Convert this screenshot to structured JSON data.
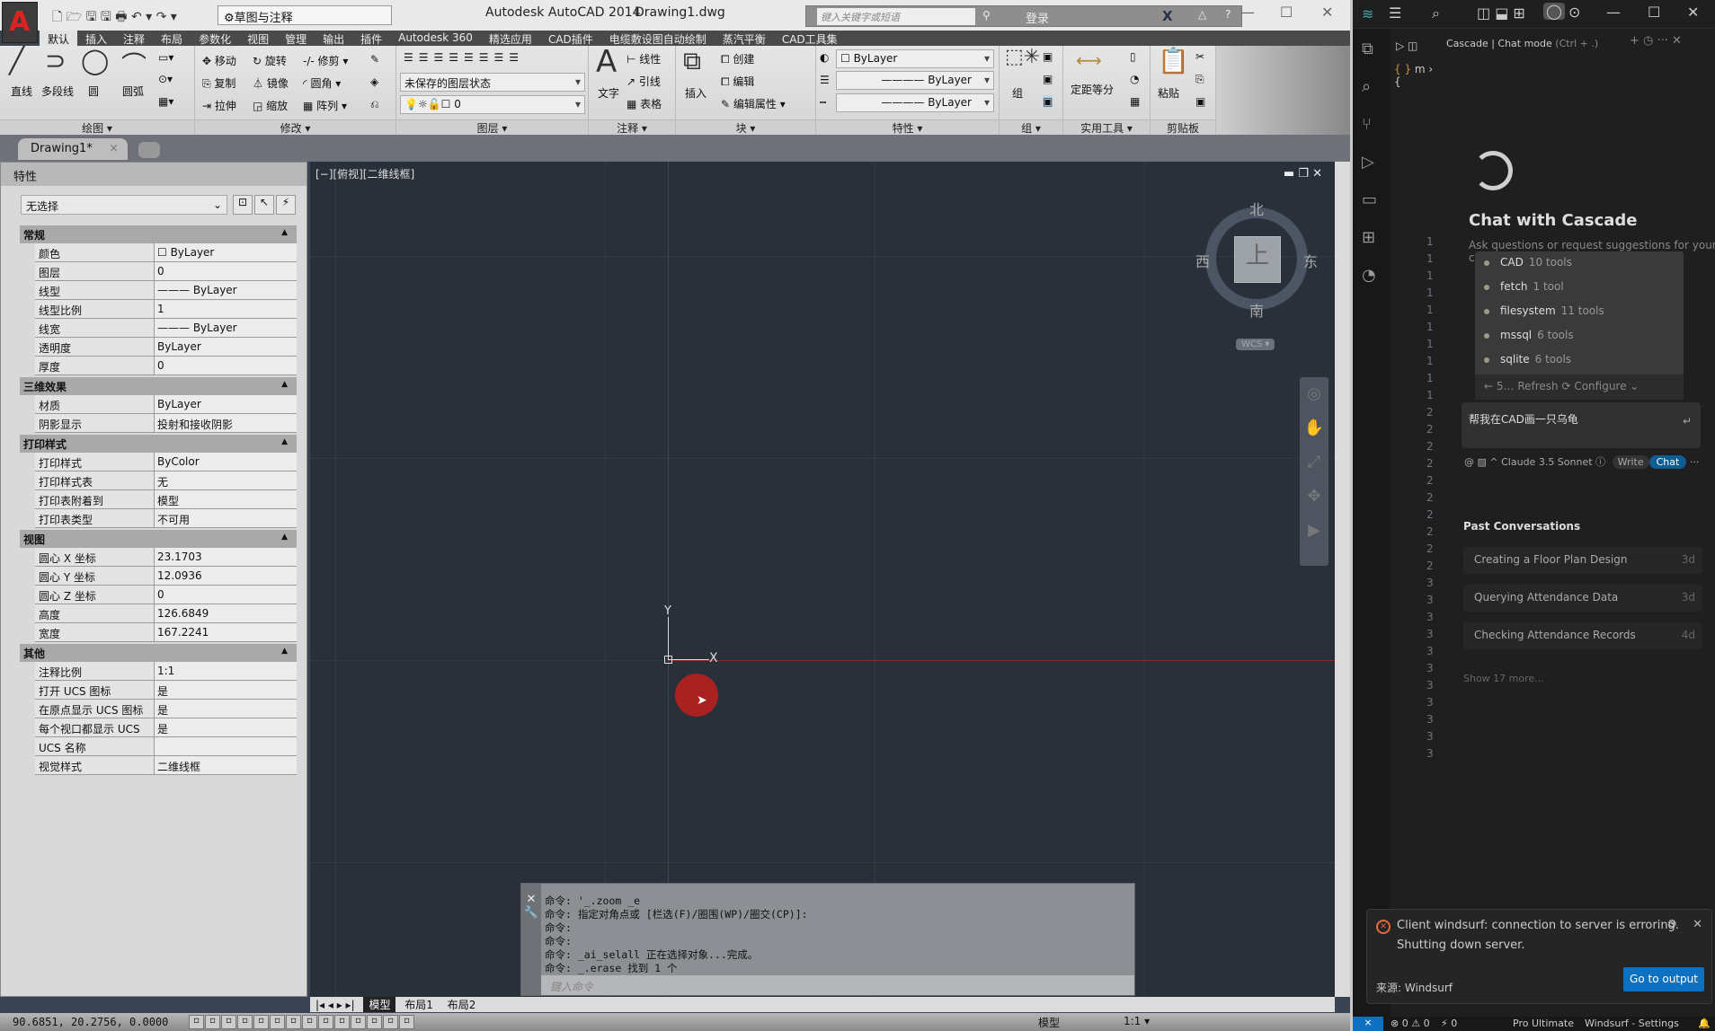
{
  "acad": {
    "title": "Autodesk AutoCAD 2014",
    "file": "Drawing1.dwg",
    "workspace": "草图与注释",
    "search_placeholder": "键入关键字或短语",
    "login": "登录",
    "menu_tabs": [
      "默认",
      "插入",
      "注释",
      "布局",
      "参数化",
      "视图",
      "管理",
      "输出",
      "插件",
      "Autodesk 360",
      "精选应用",
      "CAD插件",
      "电缆敷设图自动绘制",
      "蒸汽平衡",
      "CAD工具集"
    ],
    "ribbon": {
      "draw": {
        "label": "绘图 ▾",
        "items": [
          "直线",
          "多段线",
          "圆",
          "圆弧"
        ]
      },
      "modify": {
        "label": "修改 ▾",
        "items": [
          "移动",
          "旋转",
          "修剪",
          "复制",
          "镜像",
          "圆角",
          "拉伸",
          "缩放",
          "阵列"
        ]
      },
      "layer": {
        "label": "图层 ▾",
        "state": "未保存的图层状态",
        "current": "0"
      },
      "annotate": {
        "label": "注释 ▾",
        "text": "文字",
        "items": [
          "线性",
          "引线",
          "表格"
        ]
      },
      "block": {
        "label": "块 ▾",
        "insert": "插入",
        "items": [
          "创建",
          "编辑",
          "编辑属性"
        ]
      },
      "properties": {
        "label": "特性 ▾",
        "color": "ByLayer",
        "linetype": "ByLayer",
        "lineweight": "ByLayer"
      },
      "group": {
        "label": "组 ▾",
        "btn": "组"
      },
      "utilities": {
        "label": "实用工具 ▾",
        "btn": "定距等分"
      },
      "clipboard": {
        "label": "剪贴板",
        "btn": "粘贴"
      }
    },
    "doc_tab": "Drawing1*",
    "props": {
      "title": "特性",
      "selection": "无选择",
      "sections": [
        {
          "name": "常规",
          "rows": [
            [
              "颜色",
              "☐ ByLayer"
            ],
            [
              "图层",
              "0"
            ],
            [
              "线型",
              "——— ByLayer"
            ],
            [
              "线型比例",
              "1"
            ],
            [
              "线宽",
              "——— ByLayer"
            ],
            [
              "透明度",
              "ByLayer"
            ],
            [
              "厚度",
              "0"
            ]
          ]
        },
        {
          "name": "三维效果",
          "rows": [
            [
              "材质",
              "ByLayer"
            ],
            [
              "阴影显示",
              "投射和接收阴影"
            ]
          ]
        },
        {
          "name": "打印样式",
          "rows": [
            [
              "打印样式",
              "ByColor"
            ],
            [
              "打印样式表",
              "无"
            ],
            [
              "打印表附着到",
              "模型"
            ],
            [
              "打印表类型",
              "不可用"
            ]
          ]
        },
        {
          "name": "视图",
          "rows": [
            [
              "圆心 X 坐标",
              "23.1703"
            ],
            [
              "圆心 Y 坐标",
              "12.0936"
            ],
            [
              "圆心 Z 坐标",
              "0"
            ],
            [
              "高度",
              "126.6849"
            ],
            [
              "宽度",
              "167.2241"
            ]
          ]
        },
        {
          "name": "其他",
          "rows": [
            [
              "注释比例",
              "1:1"
            ],
            [
              "打开 UCS 图标",
              "是"
            ],
            [
              "在原点显示 UCS 图标",
              "是"
            ],
            [
              "每个视口都显示 UCS",
              "是"
            ],
            [
              "UCS 名称",
              ""
            ],
            [
              "视觉样式",
              "二维线框"
            ]
          ]
        }
      ]
    },
    "viewport_label": "[−][俯视][二维线框]",
    "viewcube": {
      "n": "北",
      "s": "南",
      "e": "东",
      "w": "西",
      "top": "上",
      "wcs": "WCS ▾"
    },
    "ucs": {
      "x": "X",
      "y": "Y"
    },
    "command_lines": [
      "命令: '_.zoom _e",
      "命令: 指定对角点或 [栏选(F)/圈围(WP)/圈交(CP)]:",
      "命令:",
      "命令:",
      "命令: _ai_selall 正在选择对象...完成。",
      "命令: _.erase 找到 1 个"
    ],
    "command_placeholder": "键入命令",
    "layout_tabs": [
      "模型",
      "布局1",
      "布局2"
    ],
    "coords": "90.6851, 20.2756, 0.0000",
    "status_model": "模型",
    "status_scale": "1:1 ▾"
  },
  "vscode": {
    "cascade_header": "Cascade | Chat mode",
    "cascade_shortcut": "(Ctrl + .)",
    "chat_title": "Chat with Cascade",
    "chat_sub": "Ask questions or request suggestions for your code",
    "tools": [
      {
        "name": "CAD",
        "count": "10 tools"
      },
      {
        "name": "fetch",
        "count": "1 tool"
      },
      {
        "name": "filesystem",
        "count": "11 tools"
      },
      {
        "name": "mssql",
        "count": "6 tools"
      },
      {
        "name": "sqlite",
        "count": "6 tools"
      }
    ],
    "tools_footer": "←  5…  Refresh ⟳   Configure ⌄",
    "input": "帮我在CAD画一只乌龟",
    "model": "Claude 3.5 Sonnet",
    "write": "Write",
    "chat": "Chat",
    "past_title": "Past Conversations",
    "past": [
      {
        "title": "Creating a Floor Plan Design",
        "age": "3d"
      },
      {
        "title": "Querying Attendance Data",
        "age": "3d"
      },
      {
        "title": "Checking Attendance Records",
        "age": "4d"
      }
    ],
    "show_more": "Show 17 more...",
    "notification": {
      "line1": "Client windsurf: connection to server is erroring.",
      "line2": "Shutting down server.",
      "source": "来源: Windsurf",
      "button": "Go to output"
    },
    "status": {
      "problems": "⊗ 0 ⚠ 0",
      "ports": "⚡ 0",
      "plan": "Pro Ultimate",
      "settings": "Windsurf - Settings"
    },
    "gutter_lines": [
      "1",
      "1",
      "1",
      "1",
      "1",
      "1",
      "1",
      "1",
      "1",
      "1",
      "2",
      "2",
      "2",
      "2",
      "2",
      "2",
      "2",
      "2",
      "2",
      "2",
      "3",
      "3",
      "3",
      "3",
      "3",
      "3",
      "3",
      "3",
      "3",
      "3",
      "3"
    ]
  },
  "colors": {
    "viewport_bg": "#2a3039",
    "x_axis": "#8b2a2a",
    "accent_blue": "#0e70c0",
    "cursor_red": "#b82020"
  }
}
